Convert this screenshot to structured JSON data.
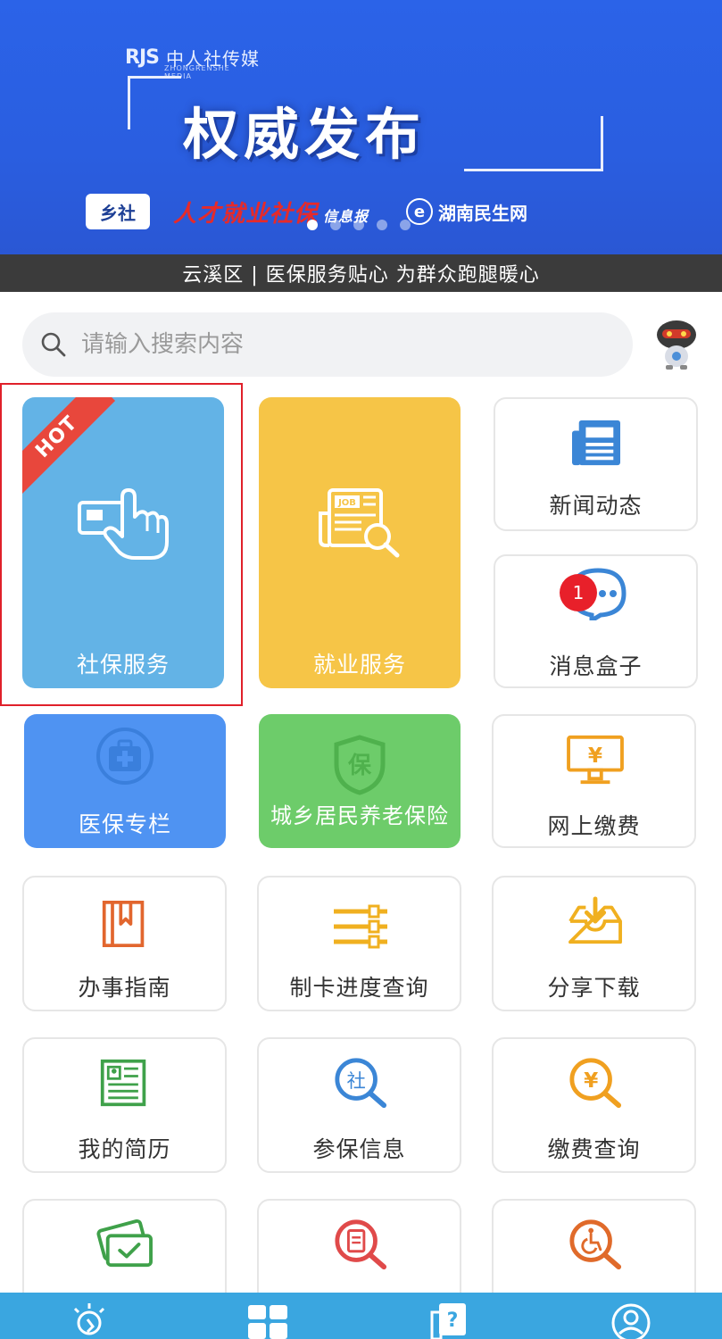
{
  "banner": {
    "logo_mark": "RJS",
    "logo_text": "中人社传媒",
    "logo_subtext": "ZHONGRENSHE MEDIA",
    "headline": "权威发布",
    "partner_1": "乡社",
    "partner_2": "人才就业社保",
    "partner_2_suffix": "信息报",
    "partner_3": "湖南民生网",
    "partner_3_mark": "e",
    "slide_count": 5,
    "active_slide": 1,
    "caption": "云溪区 | 医保服务贴心 为群众跑腿暖心"
  },
  "search": {
    "placeholder": "请输入搜索内容"
  },
  "tiles": {
    "social_security": {
      "label": "社保服务",
      "ribbon": "HOT"
    },
    "employment": {
      "label": "就业服务"
    },
    "news": {
      "label": "新闻动态"
    },
    "messages": {
      "label": "消息盒子",
      "badge": "1"
    },
    "medical": {
      "label": "医保专栏"
    },
    "pension": {
      "label": "城乡居民养老保险"
    },
    "online_payment": {
      "label": "网上缴费"
    },
    "guide": {
      "label": "办事指南"
    },
    "card_progress": {
      "label": "制卡进度查询"
    },
    "share_download": {
      "label": "分享下载"
    },
    "my_resume": {
      "label": "我的简历"
    },
    "insurance_info": {
      "label": "参保信息"
    },
    "payment_query": {
      "label": "缴费查询"
    }
  },
  "colors": {
    "banner_blue": "#2b5fe4",
    "tile_blue_light": "#63b3e6",
    "tile_yellow": "#f6c547",
    "tile_blue": "#4f93f2",
    "tile_green": "#6dcc6a",
    "nav_bg": "#3aa6e0",
    "hot_red": "#e8473c",
    "highlight_red": "#e0202a"
  }
}
